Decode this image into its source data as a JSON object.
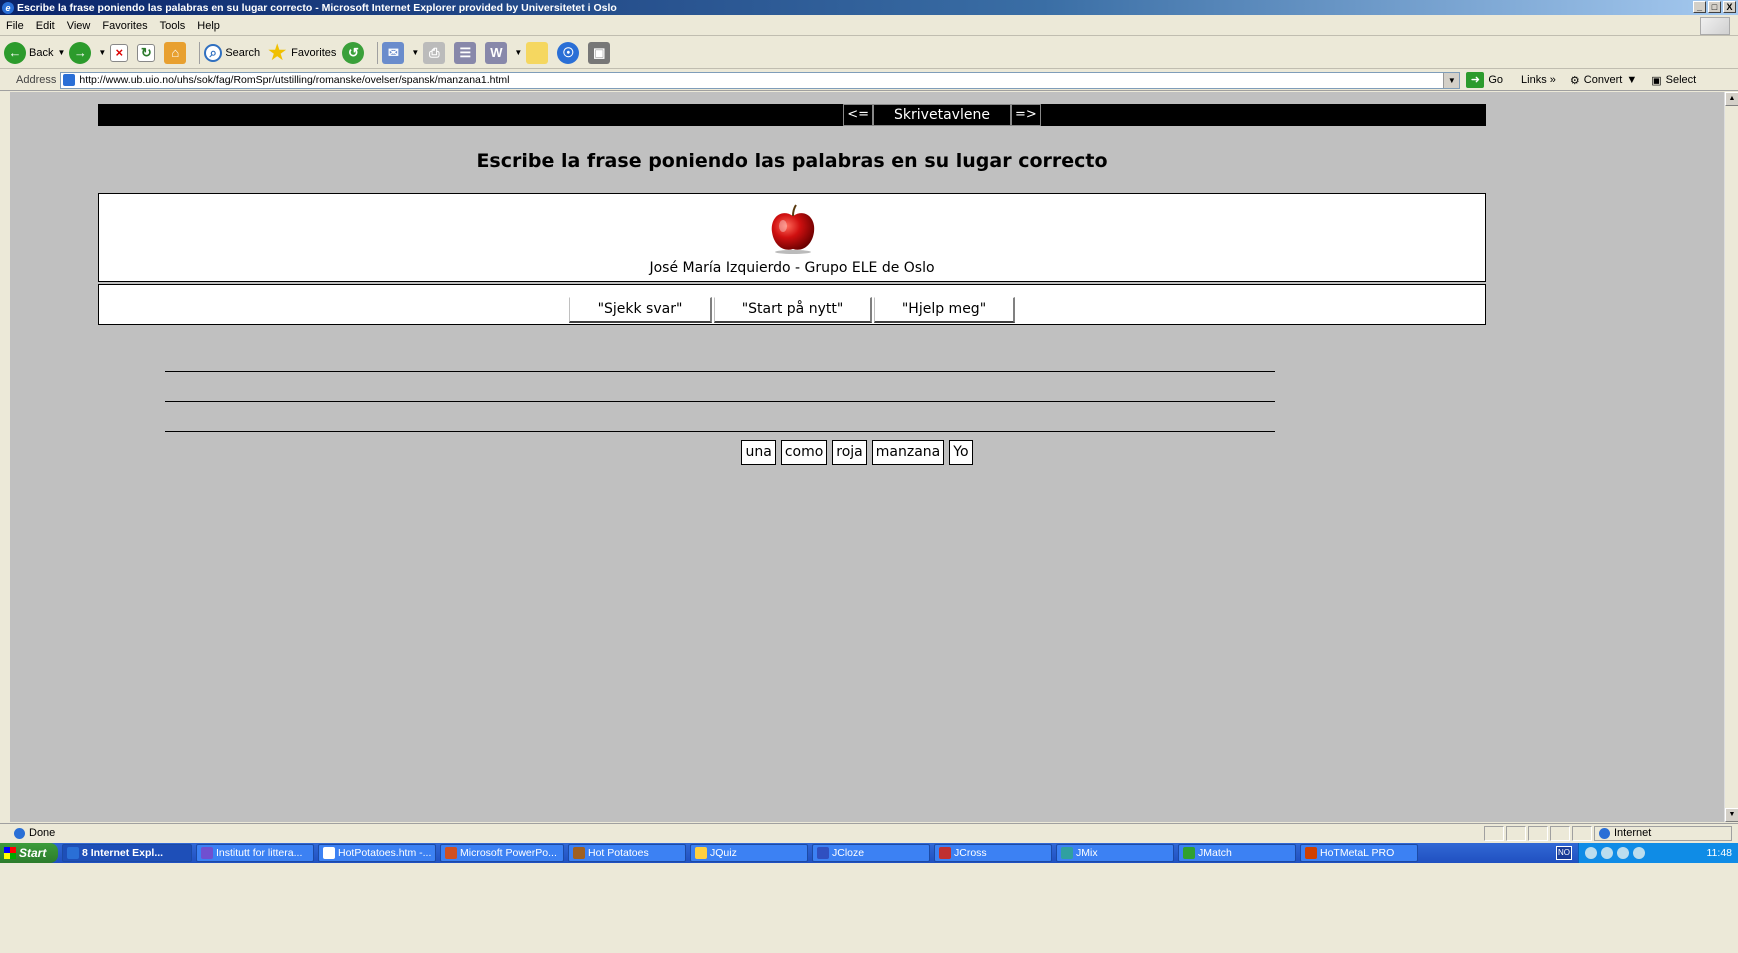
{
  "window": {
    "title": "Escribe la frase poniendo las palabras en su lugar correcto - Microsoft Internet Explorer provided by Universitetet i Oslo",
    "buttons": [
      "_",
      "□",
      "X"
    ]
  },
  "menu": {
    "items": [
      "File",
      "Edit",
      "View",
      "Favorites",
      "Tools",
      "Help"
    ]
  },
  "toolbar": {
    "back_label": "Back",
    "search_label": "Search",
    "favorites_label": "Favorites"
  },
  "address": {
    "label": "Address",
    "url": "http://www.ub.uio.no/uhs/sok/fag/RomSpr/utstilling/romanske/ovelser/spansk/manzana1.html",
    "go_label": "Go",
    "links_label": "Links",
    "convert_label": "Convert",
    "select_label": "Select"
  },
  "page": {
    "nav_prev": "<=",
    "nav_title": "Skrivetavlene",
    "nav_next": "=>",
    "heading": "Escribe la frase poniendo las palabras en su lugar correcto",
    "author": "José María Izquierdo - Grupo ELE de Oslo",
    "buttons": [
      "\"Sjekk svar\"",
      "\"Start på nytt\"",
      "\"Hjelp meg\""
    ],
    "words": [
      "una",
      "como",
      "roja",
      "manzana",
      "Yo"
    ]
  },
  "status": {
    "text": "Done",
    "zone": "Internet"
  },
  "taskbar": {
    "start": "Start",
    "tasks": [
      "8 Internet Expl...",
      "Institutt for littera...",
      "HotPotatoes.htm -...",
      "Microsoft PowerPo...",
      "Hot Potatoes",
      "JQuiz",
      "JCloze",
      "JCross",
      "JMix",
      "JMatch",
      "HoTMetaL PRO"
    ],
    "lang": "NO",
    "clock": "11:48"
  }
}
